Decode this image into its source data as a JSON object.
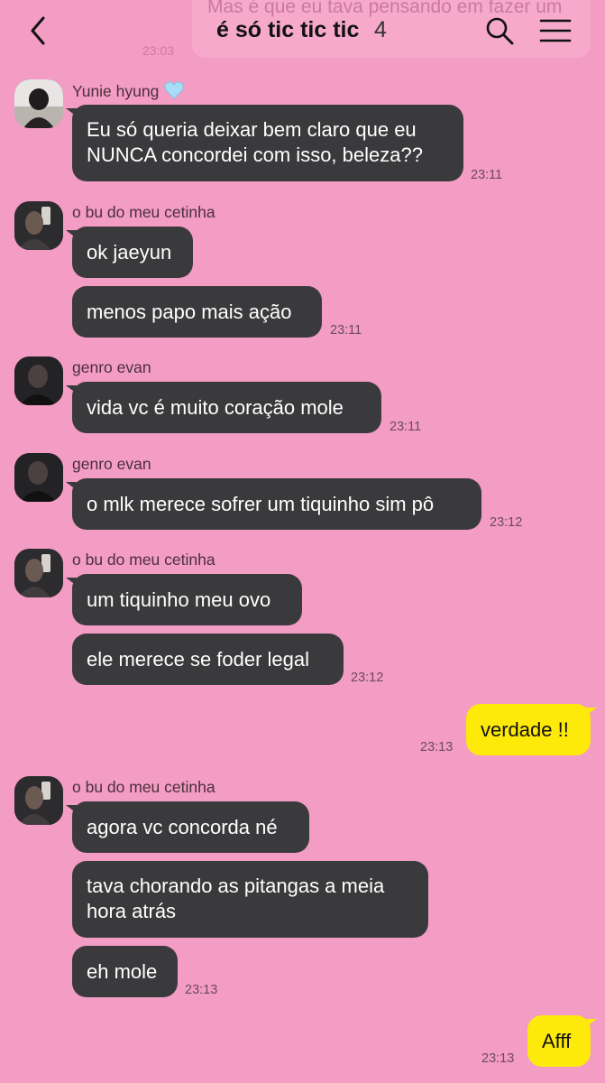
{
  "header": {
    "title": "é só tic tic tic",
    "member_count": "4",
    "ghost_preview": "Mas é que eu tava pensando em fazer um",
    "ghost_time": "23:03"
  },
  "icons": {
    "back": "chevron-left-icon",
    "search": "search-icon",
    "menu": "hamburger-menu-icon",
    "heart": "blue-heart-icon"
  },
  "colors": {
    "background": "#f39cc4",
    "bubble_other": "#3a3a3c",
    "bubble_mine": "#fde90a",
    "heart": "#a9dcf5"
  },
  "messages": [
    {
      "sender": "Yunie hyung",
      "text": "Eu só queria deixar bem claro que eu NUNCA concordei com isso, beleza??",
      "time": "23:11"
    },
    {
      "sender": "o bu do meu cetinha",
      "text": "ok jaeyun"
    },
    {
      "text": "menos papo mais ação",
      "time": "23:11"
    },
    {
      "sender": "genro evan",
      "text": "vida vc é muito coração mole",
      "time": "23:11"
    },
    {
      "sender": "genro evan",
      "text": "o mlk merece sofrer um tiquinho sim pô",
      "time": "23:12"
    },
    {
      "sender": "o bu do meu cetinha",
      "text": "um tiquinho meu ovo"
    },
    {
      "text": "ele merece se foder legal",
      "time": "23:12"
    },
    {
      "mine": true,
      "text": "verdade !!",
      "time": "23:13"
    },
    {
      "sender": "o bu do meu cetinha",
      "text": "agora vc concorda né"
    },
    {
      "text": "tava chorando as pitangas a meia hora atrás"
    },
    {
      "text": "eh mole",
      "time": "23:13"
    },
    {
      "mine": true,
      "text": "Afff",
      "time": "23:13"
    }
  ]
}
